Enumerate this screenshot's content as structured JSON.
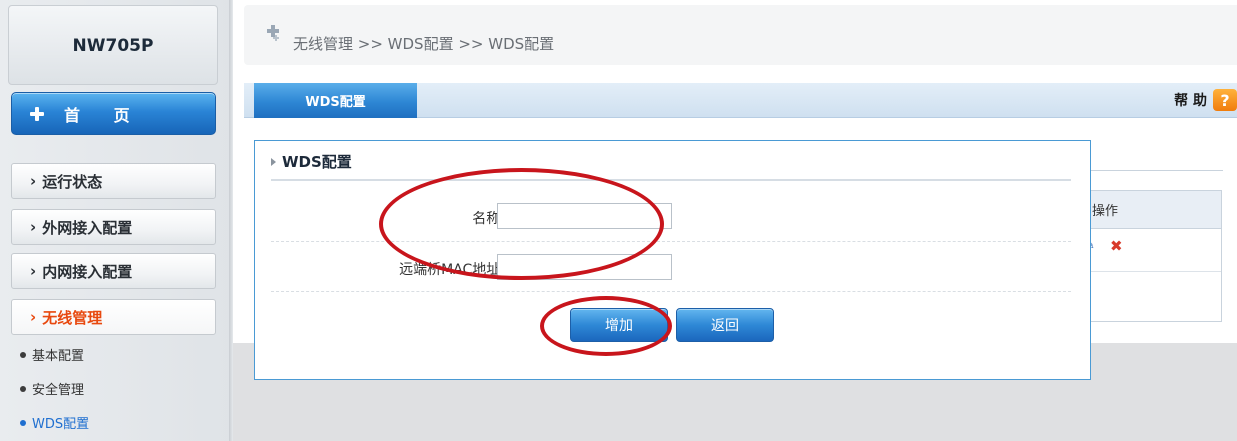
{
  "sidebar": {
    "device_name": "NW705P",
    "home_label": "首 页",
    "nav": [
      {
        "label": "运行状态"
      },
      {
        "label": "外网接入配置"
      },
      {
        "label": "内网接入配置"
      },
      {
        "label": "无线管理"
      }
    ],
    "chev": "›",
    "sub": [
      {
        "label": "基本配置"
      },
      {
        "label": "安全管理"
      },
      {
        "label": "WDS配置"
      }
    ]
  },
  "breadcrumb": "无线管理 >> WDS配置 >> WDS配置",
  "tab": {
    "label": "WDS配置"
  },
  "help": {
    "label": "帮 助",
    "icon_text": "?"
  },
  "background_table": {
    "header": "操作",
    "edit_icon": "✎",
    "delete_icon": "✖"
  },
  "dialog": {
    "title": "WDS配置",
    "fields": [
      {
        "label": "名称:",
        "value": ""
      },
      {
        "label": "远端桥MAC地址:",
        "value": ""
      }
    ],
    "add_button": "增加",
    "back_button": "返回"
  },
  "colors": {
    "accent": "#2a84d6",
    "active_nav": "#e8490f",
    "annotation": "#c8151c"
  }
}
